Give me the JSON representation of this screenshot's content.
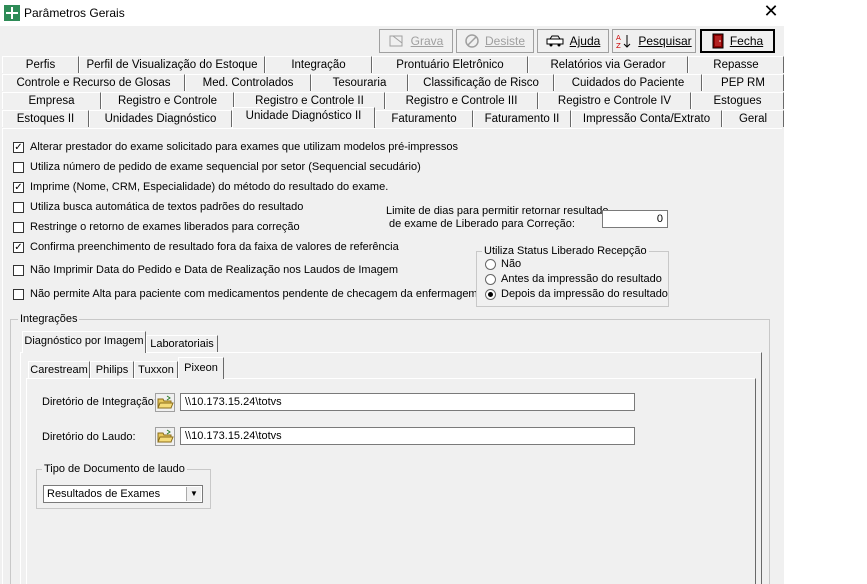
{
  "window": {
    "title": "Parâmetros Gerais",
    "close": "✕"
  },
  "toolbar": {
    "grava": "Grava",
    "desiste": "Desiste",
    "ajuda": "Ajuda",
    "pesquisar": "Pesquisar",
    "fecha": "Fecha"
  },
  "tabs_row1": [
    "Perfis",
    "Perfil de Visualização do Estoque",
    "Integração",
    "Prontuário Eletrônico",
    "Relatórios via Gerador",
    "Repasse"
  ],
  "tabs_row2": [
    "Controle e Recurso de Glosas",
    "Med. Controlados",
    "Tesouraria",
    "Classificação de Risco",
    "Cuidados do Paciente",
    "PEP RM"
  ],
  "tabs_row3": [
    "Empresa",
    "Registro e Controle",
    "Registro e Controle II",
    "Registro e Controle III",
    "Registro e Controle IV",
    "Estogues"
  ],
  "tabs_row4": [
    "Estoques II",
    "Unidades Diagnóstico",
    "Unidade Diagnóstico II",
    "Faturamento",
    "Faturamento II",
    "Impressão Conta/Extrato",
    "Geral"
  ],
  "options": [
    {
      "label": "Alterar prestador do exame solicitado para exames que utilizam modelos pré-impressos",
      "checked": true
    },
    {
      "label": "Utiliza número de pedido de exame sequencial por setor (Sequencial secudário)",
      "checked": false
    },
    {
      "label": "Imprime (Nome, CRM, Especialidade) do método do resultado do exame.",
      "checked": true
    },
    {
      "label": "Utiliza busca automática de textos padrões do resultado",
      "checked": false
    },
    {
      "label": "Restringe o retorno de exames liberados para correção",
      "checked": false
    },
    {
      "label": "Confirma preenchimento de resultado fora da faixa de valores de referência",
      "checked": true
    },
    {
      "label": "Não Imprimir Data do Pedido e Data de Realização nos Laudos de Imagem",
      "checked": false
    },
    {
      "label": "Não permite Alta para paciente com medicamentos pendente de checagem da enfermagem",
      "checked": false
    }
  ],
  "limite": {
    "line1": "Limite de dias para permitir retornar resultado",
    "line2": "de exame de Liberado para Correção:",
    "value": "0"
  },
  "status_group": {
    "title": "Utiliza Status Liberado Recepção",
    "options": [
      {
        "label": "Não",
        "selected": false
      },
      {
        "label": "Antes da impressão do resultado",
        "selected": false
      },
      {
        "label": "Depois da impressão do resultado",
        "selected": true
      }
    ]
  },
  "integracoes": {
    "title": "Integrações",
    "tabs": [
      "Diagnóstico por Imagem",
      "Laboratoriais"
    ],
    "subtabs": [
      "Carestream",
      "Philips",
      "Tuxxon",
      "Pixeon"
    ],
    "dir_integracao_label": "Diretório de Integração:",
    "dir_integracao_value": "\\\\10.173.15.24\\totvs",
    "dir_laudo_label": "Diretório do Laudo:",
    "dir_laudo_value": "\\\\10.173.15.24\\totvs",
    "tipo_doc_title": "Tipo de Documento de laudo",
    "tipo_doc_value": "Resultados de Exames"
  }
}
